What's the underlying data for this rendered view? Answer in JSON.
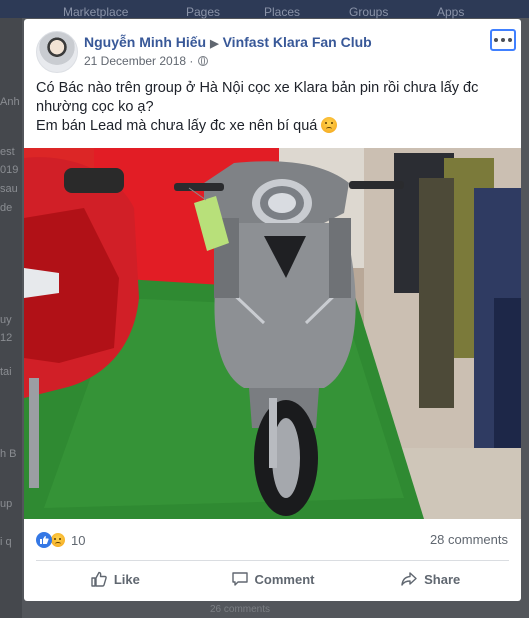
{
  "background": {
    "nav_items": [
      "Marketplace",
      "Pages",
      "Places",
      "Groups",
      "Apps"
    ],
    "left_fragments": [
      "Anh",
      "est",
      "019",
      "sau",
      "de",
      "uy",
      "12",
      "tai",
      "h B",
      "up",
      "i q"
    ],
    "bottom_fragment": "26 comments"
  },
  "post": {
    "author": "Nguyễn Minh Hiếu",
    "group": "Vinfast Klara Fan Club",
    "date": "21 December 2018 ·",
    "text_line1": "Có Bác nào trên group ở Hà Nội cọc xe Klara bản pin rồi chưa lấy đc nhường cọc ko ạ?",
    "text_line2": "Em bán Lead mà chưa lấy đc xe nên bí quá",
    "image_alt": "Grey Vinfast Klara scooter on green carpet in showroom next to a red scooter",
    "reaction_count": "10",
    "comments_count": "28 comments",
    "actions": {
      "like": "Like",
      "comment": "Comment",
      "share": "Share"
    }
  },
  "colors": {
    "link": "#385898",
    "accent": "#3578e5",
    "focus": "#4080ff"
  }
}
